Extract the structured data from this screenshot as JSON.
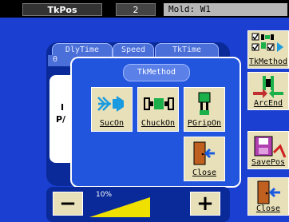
{
  "topbar": {
    "program": "TkPos",
    "step": "2",
    "mold": "Mold: W1"
  },
  "tabs": [
    "DlyTime",
    "Speed",
    "TkTime"
  ],
  "tab_partial": "0",
  "panel_text": [
    "I",
    "P/"
  ],
  "modal": {
    "title": "TkMethod",
    "buttons": [
      {
        "label": "SucOn",
        "icon": "suction-on-icon"
      },
      {
        "label": "ChuckOn",
        "icon": "chuck-on-icon"
      },
      {
        "label": "PGripOn",
        "icon": "pgrip-on-icon"
      }
    ],
    "close_label": "Close"
  },
  "sidebar": [
    {
      "label": "TkMethod",
      "icon": "tkmethod-icon"
    },
    {
      "label": "ArcEnd",
      "icon": "arc-end-icon"
    },
    {
      "label": "SavePos",
      "icon": "save-position-icon"
    },
    {
      "label": "Close",
      "icon": "door-exit-icon"
    }
  ],
  "speed": {
    "percent_label": "10%",
    "value": 0.1
  },
  "colors": {
    "background": "#1b3fd0",
    "button_face": "#e8e0b8",
    "accent_yellow": "#f0e000"
  }
}
